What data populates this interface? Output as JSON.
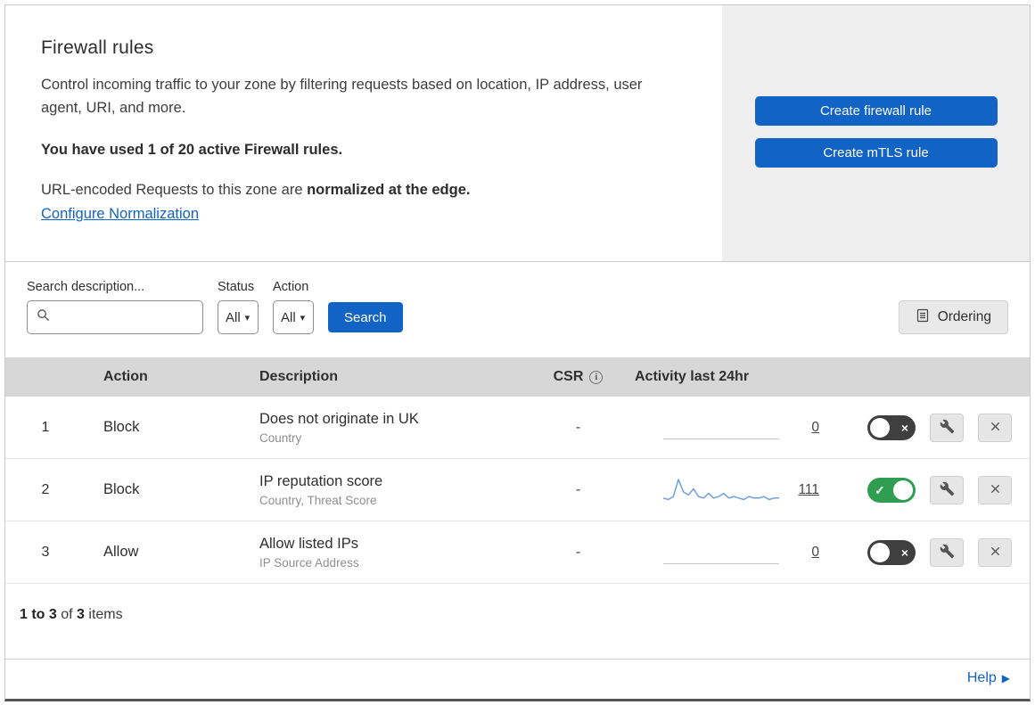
{
  "colors": {
    "accent": "#1163c6",
    "toggle_on": "#2f9e51",
    "toggle_off": "#3f3f3f",
    "sparkline": "#6f9fe0",
    "link": "#1163c6"
  },
  "header": {
    "title": "Firewall rules",
    "description": "Control incoming traffic to your zone by filtering requests based on location, IP address, user agent, URI, and more.",
    "usage": "You have used 1 of 20 active Firewall rules.",
    "normalization_prefix": "URL-encoded Requests to this zone are ",
    "normalization_bold": "normalized at the edge.",
    "configure_link": "Configure Normalization",
    "create_firewall_button": "Create firewall rule",
    "create_mtls_button": "Create mTLS rule"
  },
  "filters": {
    "search_label": "Search description...",
    "status_label": "Status",
    "status_value": "All",
    "action_label": "Action",
    "action_value": "All",
    "search_button": "Search",
    "ordering_button": "Ordering"
  },
  "table": {
    "headers": {
      "action": "Action",
      "description": "Description",
      "csr": "CSR",
      "activity": "Activity last 24hr"
    },
    "rows": [
      {
        "priority": "1",
        "action": "Block",
        "description": "Does not originate in UK",
        "fields": "Country",
        "csr": "-",
        "activity_count": "0",
        "enabled": false,
        "sparkline": null
      },
      {
        "priority": "2",
        "action": "Block",
        "description": "IP reputation score",
        "fields": "Country, Threat Score",
        "csr": "-",
        "activity_count": "111",
        "enabled": true,
        "sparkline": [
          3,
          2,
          4,
          15,
          7,
          5,
          9,
          4,
          3,
          6,
          3,
          4,
          6,
          3,
          4,
          3,
          2,
          4,
          3,
          3,
          4,
          2,
          3,
          3
        ]
      },
      {
        "priority": "3",
        "action": "Allow",
        "description": "Allow listed IPs",
        "fields": "IP Source Address",
        "csr": "-",
        "activity_count": "0",
        "enabled": false,
        "sparkline": null
      }
    ]
  },
  "footer": {
    "range": "1 to 3",
    "of": " of ",
    "total": "3",
    "items": " items"
  },
  "bottom": {
    "help": "Help"
  }
}
